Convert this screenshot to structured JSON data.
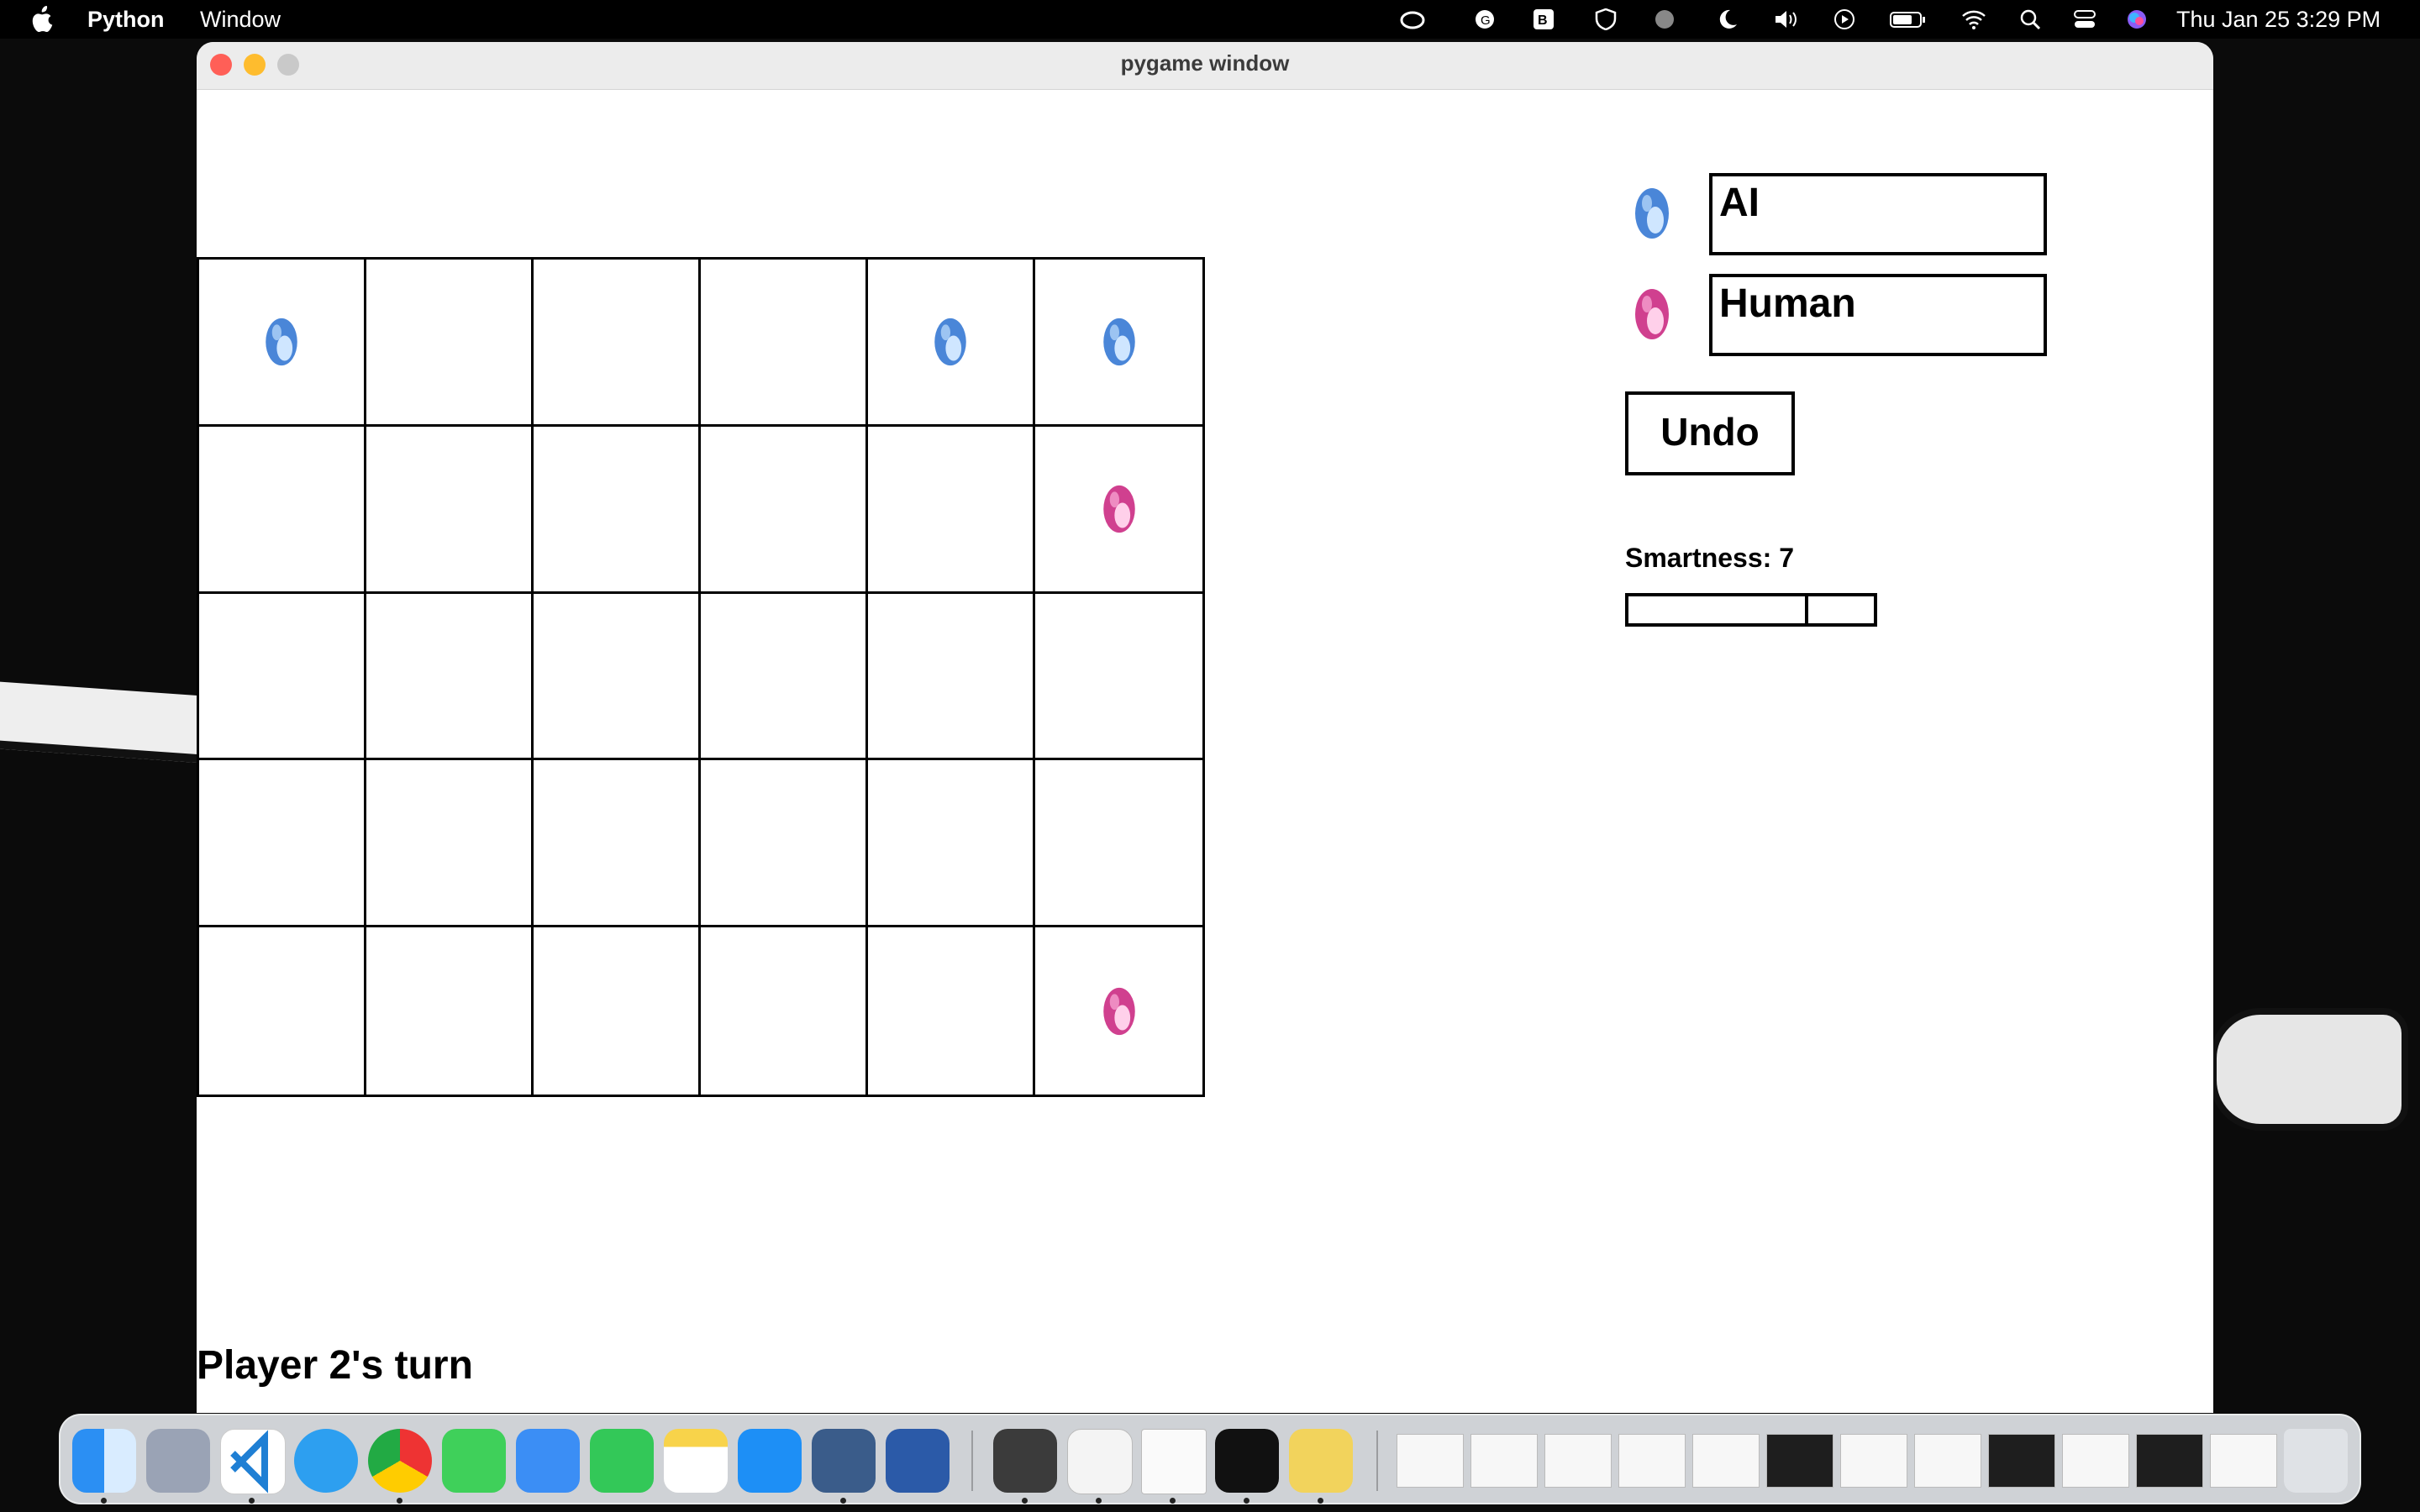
{
  "menubar": {
    "app_name": "Python",
    "menu_window": "Window",
    "clock": "Thu Jan 25  3:29 PM"
  },
  "window": {
    "title": "pygame window"
  },
  "game": {
    "board": {
      "rows": 5,
      "cols": 6,
      "pieces": [
        {
          "row": 0,
          "col": 0,
          "player": "ai"
        },
        {
          "row": 0,
          "col": 4,
          "player": "ai"
        },
        {
          "row": 0,
          "col": 5,
          "player": "ai"
        },
        {
          "row": 1,
          "col": 5,
          "player": "human"
        },
        {
          "row": 4,
          "col": 5,
          "player": "human"
        }
      ]
    },
    "players": {
      "ai_label": "AI",
      "human_label": "Human"
    },
    "undo_label": "Undo",
    "smartness_label": "Smartness: 7",
    "smartness_value": 7,
    "status_text": "Player 2's turn"
  },
  "colors": {
    "ai_gem": "#4a86d8",
    "human_gem": "#d0408f",
    "close": "#ff5f57",
    "minimize": "#febc2e",
    "zoom": "#c9c9c9"
  },
  "dock": {
    "apps": [
      "finder-icon",
      "launchpad-icon",
      "vscode-icon",
      "safari-icon",
      "chrome-icon",
      "messages-icon",
      "mail-icon",
      "facetime-icon",
      "notes-icon",
      "app-store-icon",
      "system-monitor-icon",
      "word-icon",
      "sublime-text-icon",
      "textedit-icon",
      "blank-document-icon",
      "terminal-icon",
      "python-launcher-icon",
      "trash-icon"
    ]
  }
}
